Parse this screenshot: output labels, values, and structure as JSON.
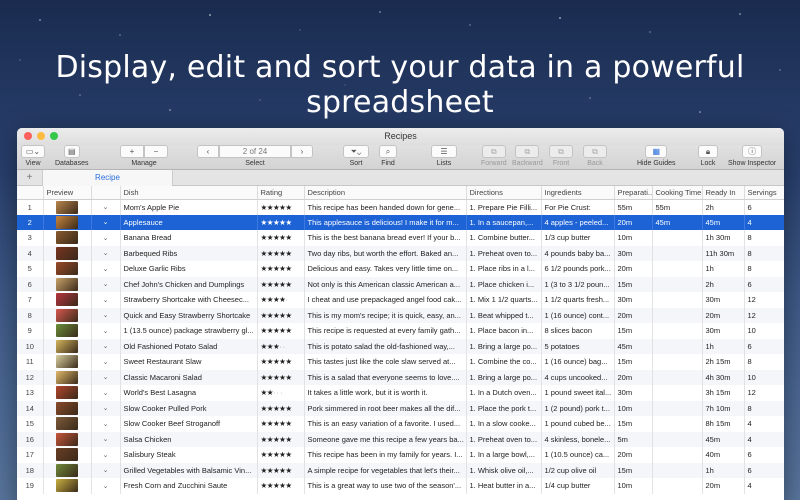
{
  "headline": "Display, edit and sort your data in a powerful spreadsheet",
  "window": {
    "title": "Recipes"
  },
  "toolbar": {
    "view": "View",
    "databases": "Databases",
    "manage": "Manage",
    "pager": "2 of 24",
    "select": "Select",
    "sort": "Sort",
    "find": "Find",
    "lists": "Lists",
    "forward": "Forward",
    "backward": "Backward",
    "front": "Front",
    "back": "Back",
    "hide_guides": "Hide Guides",
    "lock": "Lock",
    "show_inspector": "Show Inspector"
  },
  "tabs": {
    "add": "+",
    "active": "Recipe"
  },
  "columns": [
    "",
    "Preview",
    "",
    "Dish",
    "Rating",
    "Description",
    "Directions",
    "Ingredients",
    "Preparati...",
    "Cooking Time",
    "Ready In",
    "Servings"
  ],
  "rows": [
    {
      "n": "1",
      "dish": "Mom's Apple Pie",
      "stars": 5,
      "desc": "This recipe has been handed down for gene...",
      "dir": "1. Prepare Pie Filli...",
      "ing": "For Pie Crust:",
      "prep": "55m",
      "cook": "55m",
      "ready": "2h",
      "serv": "6",
      "color": "#b9864b"
    },
    {
      "n": "2",
      "dish": "Applesauce",
      "stars": 5,
      "desc": "This applesauce is delicious! I make it for m...",
      "dir": "1. In a saucepan,...",
      "ing": "4 apples - peeled...",
      "prep": "20m",
      "cook": "45m",
      "ready": "45m",
      "serv": "4",
      "color": "#c7843d"
    },
    {
      "n": "3",
      "dish": "Banana Bread",
      "stars": 5,
      "desc": "This is the best banana bread ever! If your b...",
      "dir": "1. Combine butter...",
      "ing": "1/3 cup butter",
      "prep": "10m",
      "cook": "",
      "ready": "1h 30m",
      "serv": "8",
      "color": "#8a5a2e"
    },
    {
      "n": "4",
      "dish": "Barbequed Ribs",
      "stars": 5,
      "desc": "Two day ribs, but worth the effort. Baked an...",
      "dir": "1. Preheat oven to...",
      "ing": "4 pounds baby ba...",
      "prep": "30m",
      "cook": "",
      "ready": "11h 30m",
      "serv": "8",
      "color": "#7a3522"
    },
    {
      "n": "5",
      "dish": "Deluxe Garlic Ribs",
      "stars": 5,
      "desc": "Delicious and easy. Takes very little time on...",
      "dir": "1. Place ribs in a l...",
      "ing": "6 1/2 pounds pork...",
      "prep": "20m",
      "cook": "",
      "ready": "1h",
      "serv": "8",
      "color": "#9b4a2a"
    },
    {
      "n": "6",
      "dish": "Chef John's Chicken and Dumplings",
      "stars": 5,
      "desc": "Not only is this American classic American a...",
      "dir": "1. Place chicken i...",
      "ing": "1 (3 to 3 1/2 poun...",
      "prep": "15m",
      "cook": "",
      "ready": "2h",
      "serv": "6",
      "color": "#c9a36a"
    },
    {
      "n": "7",
      "dish": "Strawberry Shortcake with Cheesec...",
      "stars": 4,
      "desc": "I cheat and use prepackaged angel food cak...",
      "dir": "1. Mix 1 1/2 quarts...",
      "ing": "1 1/2 quarts fresh...",
      "prep": "30m",
      "cook": "",
      "ready": "30m",
      "serv": "12",
      "color": "#b5363e"
    },
    {
      "n": "8",
      "dish": "Quick and Easy Strawberry Shortcake",
      "stars": 5,
      "desc": "This is my mom's recipe; it is quick, easy, an...",
      "dir": "1. Beat whipped t...",
      "ing": "1 (16 ounce) cont...",
      "prep": "20m",
      "cook": "",
      "ready": "20m",
      "serv": "12",
      "color": "#d8584f"
    },
    {
      "n": "9",
      "dish": "1 (13.5 ounce) package strawberry gl...",
      "stars": 5,
      "desc": "This recipe is requested at every family gath...",
      "dir": "1. Place bacon in...",
      "ing": "8 slices bacon",
      "prep": "15m",
      "cook": "",
      "ready": "30m",
      "serv": "10",
      "color": "#6b8f3a"
    },
    {
      "n": "10",
      "dish": "Old Fashioned Potato Salad",
      "stars": 3,
      "desc": "This is potato salad the old-fashioned way,...",
      "dir": "1. Bring a large po...",
      "ing": "5 potatoes",
      "prep": "45m",
      "cook": "",
      "ready": "1h",
      "serv": "6",
      "color": "#d4b45c"
    },
    {
      "n": "11",
      "dish": "Sweet Restaurant Slaw",
      "stars": 5,
      "desc": "This tastes just like the cole slaw served at...",
      "dir": "1. Combine the co...",
      "ing": "1 (16 ounce) bag...",
      "prep": "15m",
      "cook": "",
      "ready": "2h 15m",
      "serv": "8",
      "color": "#d9d0a0"
    },
    {
      "n": "12",
      "dish": "Classic Macaroni Salad",
      "stars": 5,
      "desc": "This is a salad that everyone seems to love....",
      "dir": "1. Bring a large po...",
      "ing": "4 cups uncooked...",
      "prep": "20m",
      "cook": "",
      "ready": "4h 30m",
      "serv": "10",
      "color": "#e0b96a"
    },
    {
      "n": "13",
      "dish": "World's Best Lasagna",
      "stars": 2,
      "desc": "It takes a little work, but it is worth it.",
      "dir": "1. In a Dutch oven...",
      "ing": "1 pound sweet ital...",
      "prep": "30m",
      "cook": "",
      "ready": "3h 15m",
      "serv": "12",
      "color": "#b2452b"
    },
    {
      "n": "14",
      "dish": "Slow Cooker Pulled Pork",
      "stars": 5,
      "desc": "Pork simmered in root beer makes all the dif...",
      "dir": "1. Place the pork t...",
      "ing": "1 (2 pound) pork t...",
      "prep": "10m",
      "cook": "",
      "ready": "7h 10m",
      "serv": "8",
      "color": "#8a4a2a"
    },
    {
      "n": "15",
      "dish": "Slow Cooker Beef Stroganoff",
      "stars": 5,
      "desc": "This is an easy variation of a favorite. I used...",
      "dir": "1. In a slow cooke...",
      "ing": "1 pound cubed be...",
      "prep": "15m",
      "cook": "",
      "ready": "8h 15m",
      "serv": "4",
      "color": "#7d5a3a"
    },
    {
      "n": "16",
      "dish": "Salsa Chicken",
      "stars": 5,
      "desc": "Someone gave me this recipe a few years ba...",
      "dir": "1. Preheat oven to...",
      "ing": "4 skinless, bonele...",
      "prep": "5m",
      "cook": "",
      "ready": "45m",
      "serv": "4",
      "color": "#c8553a"
    },
    {
      "n": "17",
      "dish": "Salisbury Steak",
      "stars": 5,
      "desc": "This recipe has been in my family for years. I...",
      "dir": "1. In a large bowl,...",
      "ing": "1 (10.5 ounce) ca...",
      "prep": "20m",
      "cook": "",
      "ready": "40m",
      "serv": "6",
      "color": "#6a3e24"
    },
    {
      "n": "18",
      "dish": "Grilled Vegetables with Balsamic Vin...",
      "stars": 5,
      "desc": "A simple recipe for vegetables that let's their...",
      "dir": "1. Whisk olive oil,...",
      "ing": "1/2 cup olive oil",
      "prep": "15m",
      "cook": "",
      "ready": "1h",
      "serv": "6",
      "color": "#6f8a3a"
    },
    {
      "n": "19",
      "dish": "Fresh Corn and Zucchini Saute",
      "stars": 5,
      "desc": "This is a great way to use two of the season'...",
      "dir": "1. Heat butter in a...",
      "ing": "1/4 cup butter",
      "prep": "10m",
      "cook": "",
      "ready": "20m",
      "serv": "4",
      "color": "#c9b040"
    }
  ],
  "selected_row": 2
}
